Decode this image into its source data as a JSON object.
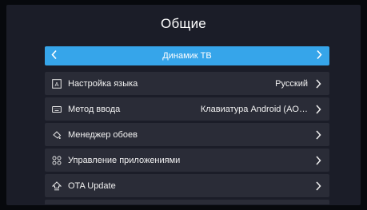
{
  "header": {
    "title": "Общие"
  },
  "selector": {
    "label": "Динамик ТВ"
  },
  "items": [
    {
      "label": "Настройка языка",
      "value": "Русский",
      "icon": "language-icon"
    },
    {
      "label": "Метод ввода",
      "value": "Клавиатура Android (AO…",
      "icon": "keyboard-icon"
    },
    {
      "label": "Менеджер обоев",
      "value": "",
      "icon": "wallpaper-icon"
    },
    {
      "label": "Управление приложениями",
      "value": "",
      "icon": "apps-grid-icon"
    },
    {
      "label": "OTA Update",
      "value": "",
      "icon": "update-icon"
    }
  ],
  "colors": {
    "accent": "#36a5ea",
    "panel": "#1b1d28",
    "row": "#2a2c37"
  }
}
